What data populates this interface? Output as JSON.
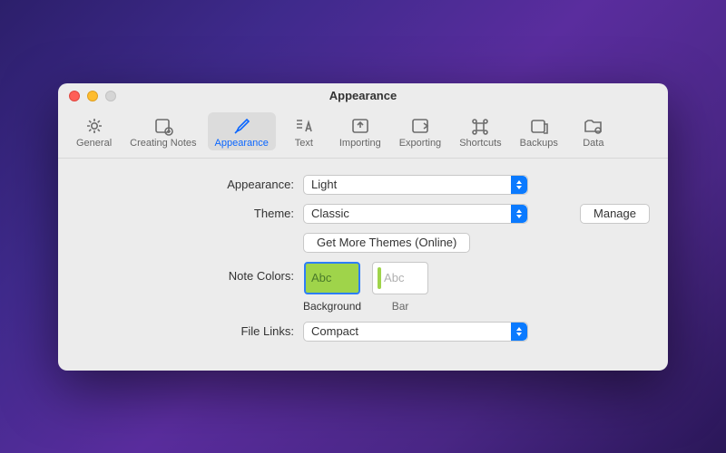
{
  "window": {
    "title": "Appearance"
  },
  "tabs": {
    "general": "General",
    "creating_notes": "Creating Notes",
    "appearance": "Appearance",
    "text": "Text",
    "importing": "Importing",
    "exporting": "Exporting",
    "shortcuts": "Shortcuts",
    "backups": "Backups",
    "data": "Data"
  },
  "labels": {
    "appearance": "Appearance:",
    "theme": "Theme:",
    "note_colors": "Note Colors:",
    "file_links": "File Links:"
  },
  "values": {
    "appearance": "Light",
    "theme": "Classic",
    "file_links": "Compact"
  },
  "buttons": {
    "manage": "Manage",
    "get_more_themes": "Get More Themes (Online)"
  },
  "swatches": {
    "sample": "Abc",
    "background": "Background",
    "bar": "Bar"
  }
}
